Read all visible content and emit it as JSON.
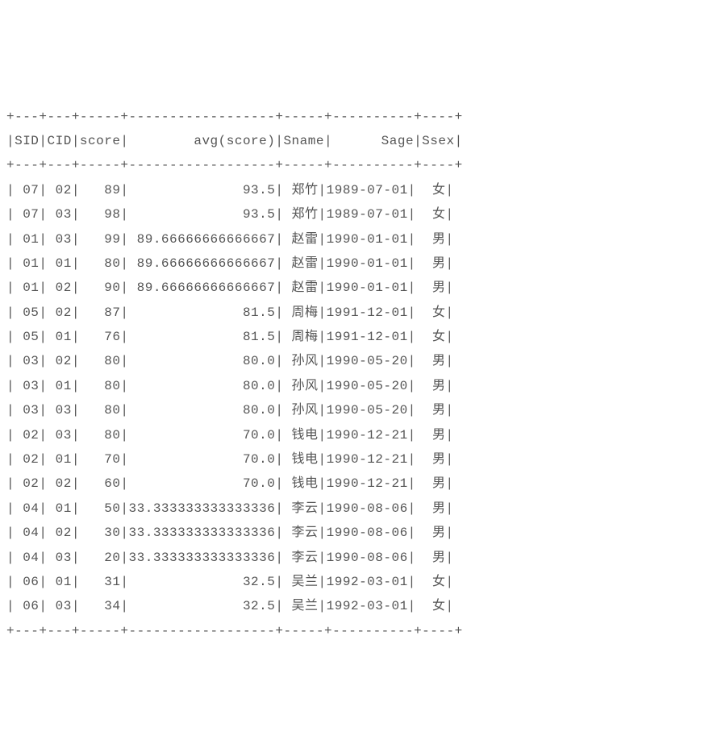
{
  "chart_data": {
    "type": "table",
    "columns": [
      "SID",
      "CID",
      "score",
      "avg(score)",
      "Sname",
      "Sage",
      "Ssex"
    ],
    "rows": [
      {
        "SID": "07",
        "CID": "02",
        "score": "89",
        "avg": "93.5",
        "Sname": "郑竹",
        "Sage": "1989-07-01",
        "Ssex": "女"
      },
      {
        "SID": "07",
        "CID": "03",
        "score": "98",
        "avg": "93.5",
        "Sname": "郑竹",
        "Sage": "1989-07-01",
        "Ssex": "女"
      },
      {
        "SID": "01",
        "CID": "03",
        "score": "99",
        "avg": "89.66666666666667",
        "Sname": "赵雷",
        "Sage": "1990-01-01",
        "Ssex": "男"
      },
      {
        "SID": "01",
        "CID": "01",
        "score": "80",
        "avg": "89.66666666666667",
        "Sname": "赵雷",
        "Sage": "1990-01-01",
        "Ssex": "男"
      },
      {
        "SID": "01",
        "CID": "02",
        "score": "90",
        "avg": "89.66666666666667",
        "Sname": "赵雷",
        "Sage": "1990-01-01",
        "Ssex": "男"
      },
      {
        "SID": "05",
        "CID": "02",
        "score": "87",
        "avg": "81.5",
        "Sname": "周梅",
        "Sage": "1991-12-01",
        "Ssex": "女"
      },
      {
        "SID": "05",
        "CID": "01",
        "score": "76",
        "avg": "81.5",
        "Sname": "周梅",
        "Sage": "1991-12-01",
        "Ssex": "女"
      },
      {
        "SID": "03",
        "CID": "02",
        "score": "80",
        "avg": "80.0",
        "Sname": "孙风",
        "Sage": "1990-05-20",
        "Ssex": "男"
      },
      {
        "SID": "03",
        "CID": "01",
        "score": "80",
        "avg": "80.0",
        "Sname": "孙风",
        "Sage": "1990-05-20",
        "Ssex": "男"
      },
      {
        "SID": "03",
        "CID": "03",
        "score": "80",
        "avg": "80.0",
        "Sname": "孙风",
        "Sage": "1990-05-20",
        "Ssex": "男"
      },
      {
        "SID": "02",
        "CID": "03",
        "score": "80",
        "avg": "70.0",
        "Sname": "钱电",
        "Sage": "1990-12-21",
        "Ssex": "男"
      },
      {
        "SID": "02",
        "CID": "01",
        "score": "70",
        "avg": "70.0",
        "Sname": "钱电",
        "Sage": "1990-12-21",
        "Ssex": "男"
      },
      {
        "SID": "02",
        "CID": "02",
        "score": "60",
        "avg": "70.0",
        "Sname": "钱电",
        "Sage": "1990-12-21",
        "Ssex": "男"
      },
      {
        "SID": "04",
        "CID": "01",
        "score": "50",
        "avg": "33.333333333333336",
        "Sname": "李云",
        "Sage": "1990-08-06",
        "Ssex": "男"
      },
      {
        "SID": "04",
        "CID": "02",
        "score": "30",
        "avg": "33.333333333333336",
        "Sname": "李云",
        "Sage": "1990-08-06",
        "Ssex": "男"
      },
      {
        "SID": "04",
        "CID": "03",
        "score": "20",
        "avg": "33.333333333333336",
        "Sname": "李云",
        "Sage": "1990-08-06",
        "Ssex": "男"
      },
      {
        "SID": "06",
        "CID": "01",
        "score": "31",
        "avg": "32.5",
        "Sname": "吴兰",
        "Sage": "1992-03-01",
        "Ssex": "女"
      },
      {
        "SID": "06",
        "CID": "03",
        "score": "34",
        "avg": "32.5",
        "Sname": "吴兰",
        "Sage": "1992-03-01",
        "Ssex": "女"
      }
    ]
  },
  "widths": {
    "SID": 3,
    "CID": 3,
    "score": 5,
    "avg": 18,
    "Sname": 5,
    "Sage": 10,
    "Ssex": 4
  }
}
